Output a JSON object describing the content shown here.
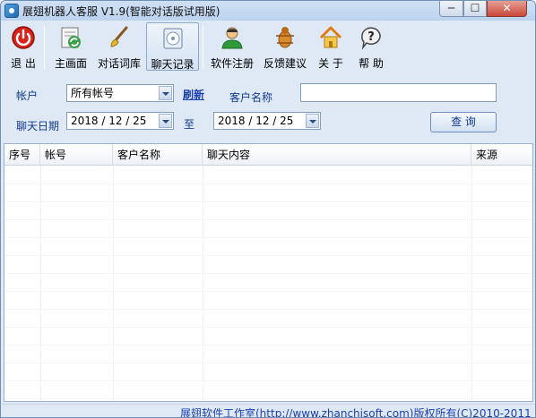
{
  "window": {
    "title": "展翅机器人客服 V1.9(智能对话版试用版)",
    "min_icon": "minimize-icon",
    "max_icon": "maximize-icon",
    "close_glyph": "✕",
    "min_glyph": "─",
    "max_glyph": "☐"
  },
  "toolbar": {
    "items": [
      {
        "label": "退 出",
        "icon": "exit-icon"
      },
      {
        "label": "主画面",
        "icon": "main-screen-icon"
      },
      {
        "label": "对话词库",
        "icon": "brush-icon"
      },
      {
        "label": "聊天记录",
        "icon": "disk-icon",
        "active": true
      },
      {
        "label": "软件注册",
        "icon": "user-icon"
      },
      {
        "label": "反馈建议",
        "icon": "bug-icon"
      },
      {
        "label": "关 于",
        "icon": "home-icon"
      },
      {
        "label": "帮 助",
        "icon": "help-icon"
      }
    ]
  },
  "filters": {
    "account_label": "帐户",
    "account_value": "所有帐号",
    "refresh_link": "刷新",
    "customer_label": "客户名称",
    "customer_value": "",
    "date_label": "聊天日期",
    "date_from": "2018 / 12 / 25",
    "date_to_label": "至",
    "date_to": "2018 / 12 / 25",
    "query_button": "查 询"
  },
  "grid": {
    "columns": [
      "序号",
      "帐号",
      "客户名称",
      "聊天内容",
      "来源"
    ]
  },
  "status": {
    "text": "展翅软件工作室(http://www.zhanchisoft.com)版权所有(C)2010-2011"
  },
  "colors": {
    "accent": "#1a3fb0",
    "chrome": "#dfe9f5",
    "close": "#c9473a"
  }
}
